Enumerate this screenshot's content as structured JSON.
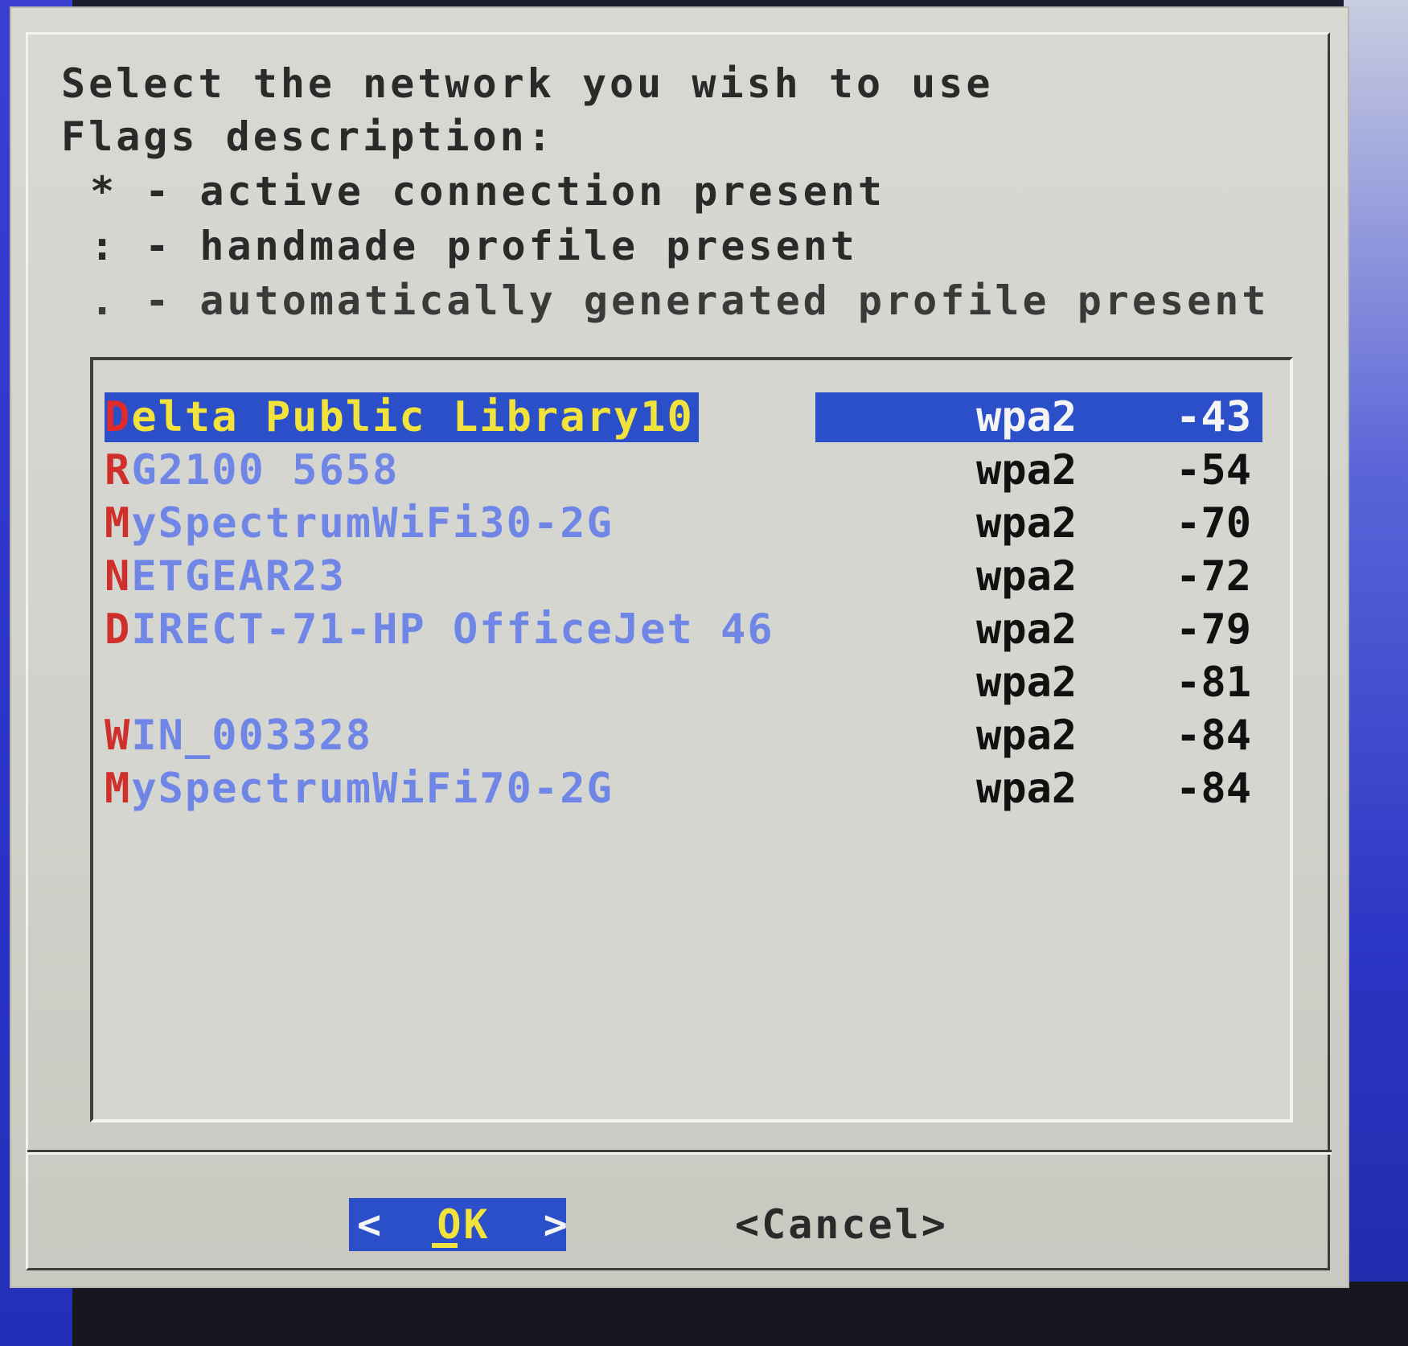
{
  "dialog": {
    "header": {
      "prompt": "Select the network you wish to use",
      "flags_title": "Flags description:",
      "flags": [
        {
          "symbol": "*",
          "desc": "- active connection present"
        },
        {
          "symbol": ":",
          "desc": "- handmade profile present"
        },
        {
          "symbol": ".",
          "desc": "- automatically generated profile present"
        }
      ]
    },
    "networks": [
      {
        "first": "D",
        "rest": "elta Public Library10",
        "security": "wpa2",
        "signal": "-43",
        "selected": true
      },
      {
        "first": "R",
        "rest": "G2100 5658",
        "security": "wpa2",
        "signal": "-54"
      },
      {
        "first": "M",
        "rest": "ySpectrumWiFi30-2G",
        "security": "wpa2",
        "signal": "-70"
      },
      {
        "first": "N",
        "rest": "ETGEAR23",
        "security": "wpa2",
        "signal": "-72"
      },
      {
        "first": "D",
        "rest": "IRECT-71-HP OfficeJet 46",
        "security": "wpa2",
        "signal": "-79"
      },
      {
        "first": "",
        "rest": "",
        "security": "wpa2",
        "signal": "-81"
      },
      {
        "first": "W",
        "rest": "IN_003328",
        "security": "wpa2",
        "signal": "-84"
      },
      {
        "first": "M",
        "rest": "ySpectrumWiFi70-2G",
        "security": "wpa2",
        "signal": "-84"
      }
    ],
    "buttons": {
      "ok_left": "<",
      "ok_label": "OK",
      "ok_right": ">",
      "cancel_label": "<Cancel>"
    }
  },
  "colors": {
    "dialog_bg": "#d6d6d0",
    "selection_bg": "#2a4fc8",
    "selection_text": "#f2e23c",
    "hotkey_red": "#d0302b",
    "ssid_blue": "#6f86e6",
    "text_dark": "#111111"
  }
}
